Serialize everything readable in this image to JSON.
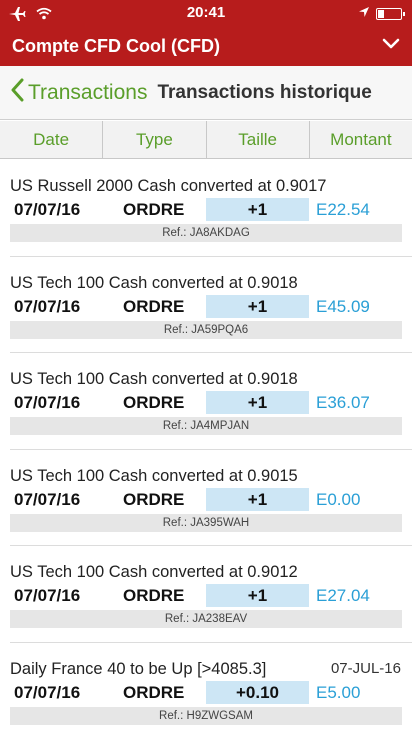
{
  "status": {
    "time": "20:41",
    "icons": [
      "airplane-icon",
      "wifi-icon",
      "location-icon",
      "battery-icon"
    ]
  },
  "account": {
    "title": "Compte CFD Cool (CFD)",
    "dropdown_icon": "chevron-down-icon"
  },
  "nav": {
    "back_label": "Transactions",
    "page_title": "Transactions historique"
  },
  "columns": [
    "Date",
    "Type",
    "Taille",
    "Montant"
  ],
  "colors": {
    "brand_red": "#b71c1c",
    "accent_green": "#5a9e2a",
    "amount_blue": "#2a9fd6",
    "size_bg": "#cde6f5"
  },
  "transactions": [
    {
      "description": "US Russell 2000 Cash converted at 0.9017",
      "right_date": "",
      "date": "07/07/16",
      "type": "ORDRE",
      "size": "+1",
      "amount": "E22.54",
      "ref": "Ref.: JA8AKDAG"
    },
    {
      "description": "US Tech 100 Cash converted at 0.9018",
      "right_date": "",
      "date": "07/07/16",
      "type": "ORDRE",
      "size": "+1",
      "amount": "E45.09",
      "ref": "Ref.: JA59PQA6"
    },
    {
      "description": "US Tech 100 Cash converted at 0.9018",
      "right_date": "",
      "date": "07/07/16",
      "type": "ORDRE",
      "size": "+1",
      "amount": "E36.07",
      "ref": "Ref.: JA4MPJAN"
    },
    {
      "description": "US Tech 100 Cash converted at 0.9015",
      "right_date": "",
      "date": "07/07/16",
      "type": "ORDRE",
      "size": "+1",
      "amount": "E0.00",
      "ref": "Ref.: JA395WAH"
    },
    {
      "description": "US Tech 100 Cash converted at 0.9012",
      "right_date": "",
      "date": "07/07/16",
      "type": "ORDRE",
      "size": "+1",
      "amount": "E27.04",
      "ref": "Ref.: JA238EAV"
    },
    {
      "description": "Daily France 40 to be Up [>4085.3]",
      "right_date": "07-JUL-16",
      "date": "07/07/16",
      "type": "ORDRE",
      "size": "+0.10",
      "amount": "E5.00",
      "ref": "Ref.: H9ZWGSAM"
    }
  ]
}
